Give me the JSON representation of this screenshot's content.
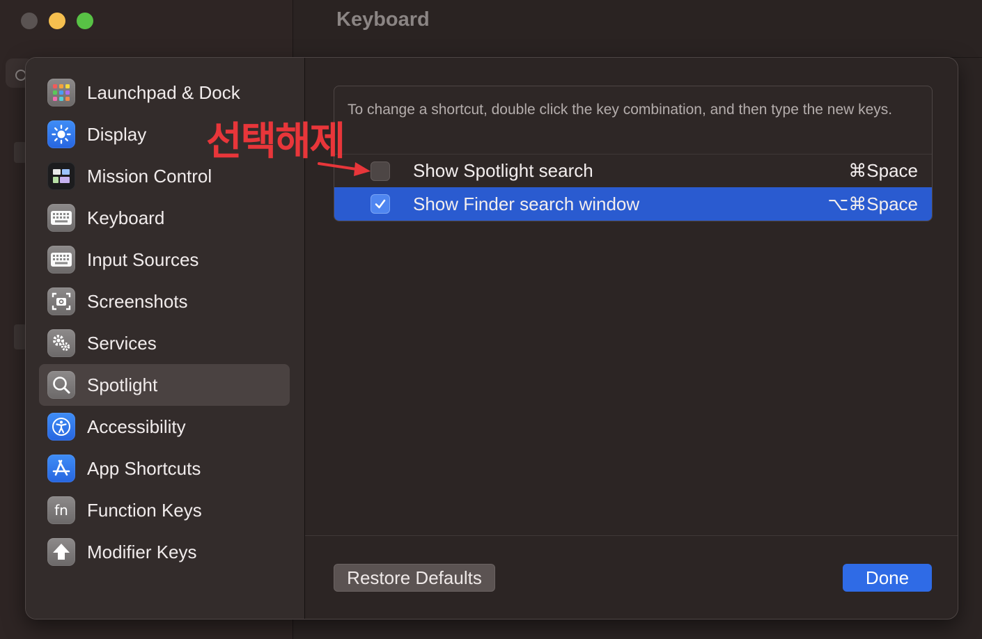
{
  "window": {
    "title": "Keyboard"
  },
  "sidebar": {
    "items": [
      {
        "label": "Launchpad & Dock",
        "icon": "launchpad-icon",
        "selected": false
      },
      {
        "label": "Display",
        "icon": "display-brightness-icon",
        "selected": false
      },
      {
        "label": "Mission Control",
        "icon": "mission-control-icon",
        "selected": false
      },
      {
        "label": "Keyboard",
        "icon": "keyboard-icon",
        "selected": false
      },
      {
        "label": "Input Sources",
        "icon": "keyboard-icon",
        "selected": false
      },
      {
        "label": "Screenshots",
        "icon": "camera-icon",
        "selected": false
      },
      {
        "label": "Services",
        "icon": "gears-icon",
        "selected": false
      },
      {
        "label": "Spotlight",
        "icon": "magnifier-icon",
        "selected": true
      },
      {
        "label": "Accessibility",
        "icon": "accessibility-icon",
        "selected": false
      },
      {
        "label": "App Shortcuts",
        "icon": "app-store-icon",
        "selected": false
      },
      {
        "label": "Function Keys",
        "icon": "fn-icon",
        "selected": false
      },
      {
        "label": "Modifier Keys",
        "icon": "shift-arrow-icon",
        "selected": false
      }
    ]
  },
  "panel": {
    "instructions": "To change a shortcut, double click the key combination, and then type the new keys.",
    "shortcuts": [
      {
        "label": "Show Spotlight search",
        "key": "⌘Space",
        "checked": false
      },
      {
        "label": "Show Finder search window",
        "key": "⌥⌘Space",
        "checked": true
      }
    ]
  },
  "footer": {
    "restore_label": "Restore Defaults",
    "done_label": "Done"
  },
  "annotation": {
    "text": "선택해제",
    "color": "#e8363a"
  },
  "colors": {
    "accent": "#2f6be6",
    "selected_row": "#2a5bd0"
  }
}
